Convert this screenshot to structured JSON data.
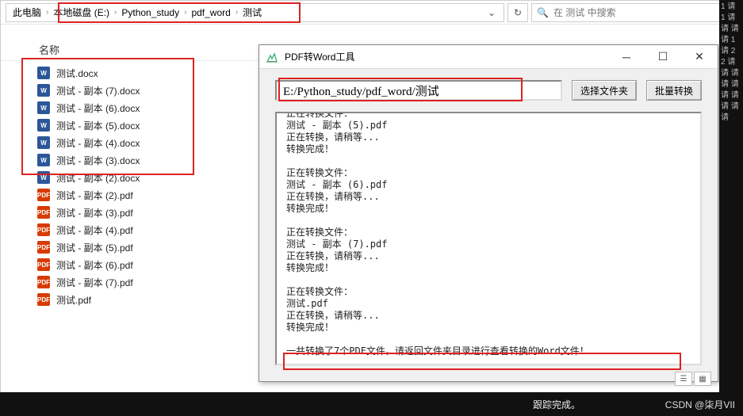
{
  "breadcrumb": {
    "parts": [
      "此电脑",
      "本地磁盘 (E:)",
      "Python_study",
      "pdf_word",
      "测试"
    ]
  },
  "search": {
    "placeholder": "在 测试 中搜索"
  },
  "columns": {
    "name": "名称"
  },
  "files": [
    {
      "name": "测试.docx",
      "type": "docx"
    },
    {
      "name": "测试 - 副本 (7).docx",
      "type": "docx"
    },
    {
      "name": "测试 - 副本 (6).docx",
      "type": "docx"
    },
    {
      "name": "测试 - 副本 (5).docx",
      "type": "docx"
    },
    {
      "name": "测试 - 副本 (4).docx",
      "type": "docx"
    },
    {
      "name": "测试 - 副本 (3).docx",
      "type": "docx"
    },
    {
      "name": "测试 - 副本 (2).docx",
      "type": "docx"
    },
    {
      "name": "测试 - 副本 (2).pdf",
      "type": "pdf"
    },
    {
      "name": "测试 - 副本 (3).pdf",
      "type": "pdf"
    },
    {
      "name": "测试 - 副本 (4).pdf",
      "type": "pdf"
    },
    {
      "name": "测试 - 副本 (5).pdf",
      "type": "pdf"
    },
    {
      "name": "测试 - 副本 (6).pdf",
      "type": "pdf"
    },
    {
      "name": "测试 - 副本 (7).pdf",
      "type": "pdf"
    },
    {
      "name": "测试.pdf",
      "type": "pdf"
    }
  ],
  "tool": {
    "title": "PDF转Word工具",
    "path_value": "E:/Python_study/pdf_word/测试",
    "btn_select": "选择文件夹",
    "btn_batch": "批量转换",
    "log": "正在转换文件：\n测试 - 副本 (5).pdf\n正在转换，请稍等...\n转换完成！\n\n正在转换文件：\n测试 - 副本 (6).pdf\n正在转换，请稍等...\n转换完成！\n\n正在转换文件：\n测试 - 副本 (7).pdf\n正在转换，请稍等...\n转换完成！\n\n正在转换文件：\n测试.pdf\n正在转换，请稍等...\n转换完成！\n\n一共转换了7个PDF文件，请返回文件夹目录进行查看转换的Word文件！"
  },
  "bottom": {
    "status": "跟踪完成。"
  },
  "icon_labels": {
    "docx": "W",
    "pdf": "PDF"
  },
  "watermark": "CSDN @柒月VII",
  "right_strip": "1\n请\n1\n请\n请\n请\n请\n1\n请\n2\n2\n请\n请\n请\n请\n请\n请\n请\n请\n请\n请"
}
